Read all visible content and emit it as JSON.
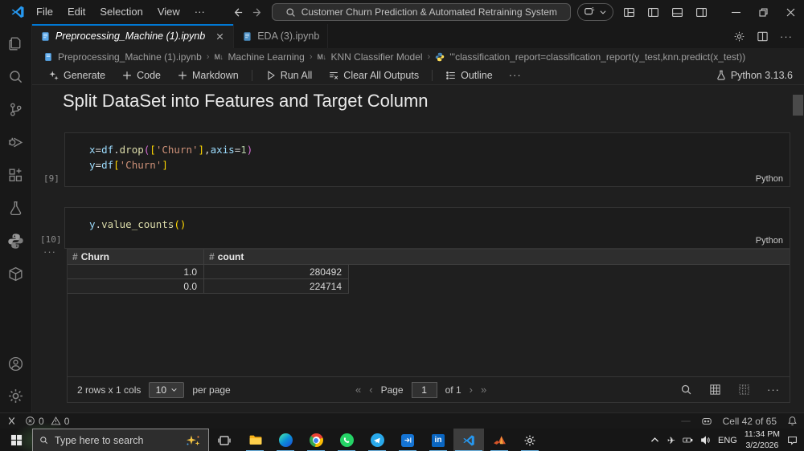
{
  "colors": {
    "accent": "#0078d4",
    "taskbar_underline": "#6cb2e0",
    "string": "#ce9178",
    "function": "#dcdcaa",
    "variable": "#9cdcfe",
    "number": "#b5cea8",
    "bracket_gold": "#ffd700",
    "bracket_pink": "#d670d6"
  },
  "title_bar": {
    "menus": [
      "File",
      "Edit",
      "Selection",
      "View",
      "···"
    ],
    "search_text": "Customer Churn Prediction & Automated Retraining System"
  },
  "tab_bar": {
    "tabs": [
      {
        "label": "Preprocessing_Machine (1).ipynb"
      },
      {
        "label": "EDA (3).ipynb"
      }
    ],
    "more": "···"
  },
  "breadcrumb": {
    "file": "Preprocessing_Machine (1).ipynb",
    "md_icon": "M↓",
    "section": "Machine Learning",
    "subsection": "KNN Classifier Model",
    "sep": "›",
    "code": "'''classification_report=classification_report(y_test,knn.predict(x_test))"
  },
  "toolbar": {
    "generate": "Generate",
    "plus": "+",
    "add_code": "Code",
    "add_markdown": "Markdown",
    "run_all": "Run All",
    "clear_outputs": "Clear All Outputs",
    "outline": "Outline",
    "more": "···",
    "kernel": "Python 3.13.6"
  },
  "notebook": {
    "heading": "Split DataSet into Features and Target Column",
    "cells": [
      {
        "exec": "[9]",
        "lang": "Python",
        "lines": [
          [
            [
              "x",
              "v"
            ],
            [
              "=",
              "o"
            ],
            [
              "df",
              "v"
            ],
            [
              ".",
              "o"
            ],
            [
              "drop",
              "f"
            ],
            [
              "(",
              "b2"
            ],
            [
              "[",
              "b1"
            ],
            [
              "'Churn'",
              "s"
            ],
            [
              "]",
              "b1"
            ],
            [
              ",",
              "o"
            ],
            [
              "axis",
              "v"
            ],
            [
              "=",
              "o"
            ],
            [
              "1",
              "n"
            ],
            [
              ")",
              "b2"
            ]
          ],
          [
            [
              "y",
              "v"
            ],
            [
              "=",
              "o"
            ],
            [
              "df",
              "v"
            ],
            [
              "[",
              "b1"
            ],
            [
              "'Churn'",
              "s"
            ],
            [
              "]",
              "b1"
            ]
          ]
        ]
      },
      {
        "exec": "[10]",
        "lang": "Python",
        "lines": [
          [
            [
              "y",
              "v"
            ],
            [
              ".",
              "o"
            ],
            [
              "value_counts",
              "f"
            ],
            [
              "(",
              "b1"
            ],
            [
              ")",
              "b1"
            ]
          ]
        ]
      }
    ],
    "output_collapse": "···",
    "output_table": {
      "hash": "#",
      "columns": [
        "Churn",
        "count"
      ],
      "rows": [
        [
          "1.0",
          "280492"
        ],
        [
          "0.0",
          "224714"
        ]
      ],
      "footer": {
        "summary": "2 rows x 1 cols",
        "page_size": "10",
        "per_page": "per page",
        "first": "«",
        "prev": "‹",
        "page_label": "Page",
        "page": "1",
        "of": "of 1",
        "next": "›",
        "last": "»",
        "more": "···"
      }
    }
  },
  "status_bar": {
    "errors": "0",
    "warnings": "0",
    "cell_indicator": "Cell 42 of 65"
  },
  "taskbar": {
    "search_placeholder": "Type here to search",
    "language": "ENG",
    "time": "11:34 PM",
    "date": "3/2/2026"
  }
}
